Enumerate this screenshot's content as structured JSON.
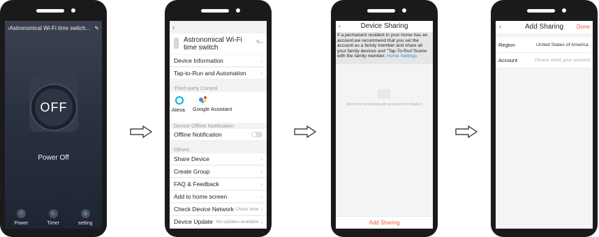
{
  "phone1": {
    "title": "Astronomical Wi-Fi time switch...",
    "power_button_label": "OFF",
    "status": "Power Off",
    "bottom_buttons": [
      {
        "label": "Power",
        "icon": "power-icon"
      },
      {
        "label": "Timer",
        "icon": "timer-icon"
      },
      {
        "label": "setting",
        "icon": "settings-icon"
      }
    ]
  },
  "phone2": {
    "device_name": "Astronomical Wi-Fi time switch",
    "rows_top": [
      {
        "label": "Device Information"
      },
      {
        "label": "Tap-to-Run and Automation"
      }
    ],
    "third_party_title": "Third-party Control",
    "alexa_label": "Alexa",
    "google_label": "Google Assistant",
    "offline_section_title": "Device Offline Notification",
    "offline_row": "Offline Notification",
    "others_title": "Others",
    "rows_others": [
      {
        "label": "Share Device",
        "value": ""
      },
      {
        "label": "Create Group",
        "value": ""
      },
      {
        "label": "FAQ & Feedback",
        "value": ""
      },
      {
        "label": "Add to home screen",
        "value": ""
      },
      {
        "label": "Check Device Network",
        "value": "Check Now"
      },
      {
        "label": "Device Update",
        "value": "No updates available"
      }
    ]
  },
  "phone3": {
    "title": "Device Sharing",
    "notice": "If a permanent resident in your home has an account,we recommend that you set the account as a family member and share all your family devices and \"Tap-To-Run\"Scene with the family member.",
    "notice_link": "Home Settings",
    "empty_text": "Device is not shared,add an account to share it",
    "add_button": "Add Sharing"
  },
  "phone4": {
    "title": "Add Sharing",
    "done": "Done",
    "region_label": "Region",
    "region_value": "United States of America",
    "account_label": "Account",
    "account_placeholder": "Please enter your account"
  },
  "colors": {
    "accent": "#f0573b",
    "link": "#2d8fd8",
    "dark_screen": "#2a3140",
    "green_icon": "#62d0a8"
  }
}
